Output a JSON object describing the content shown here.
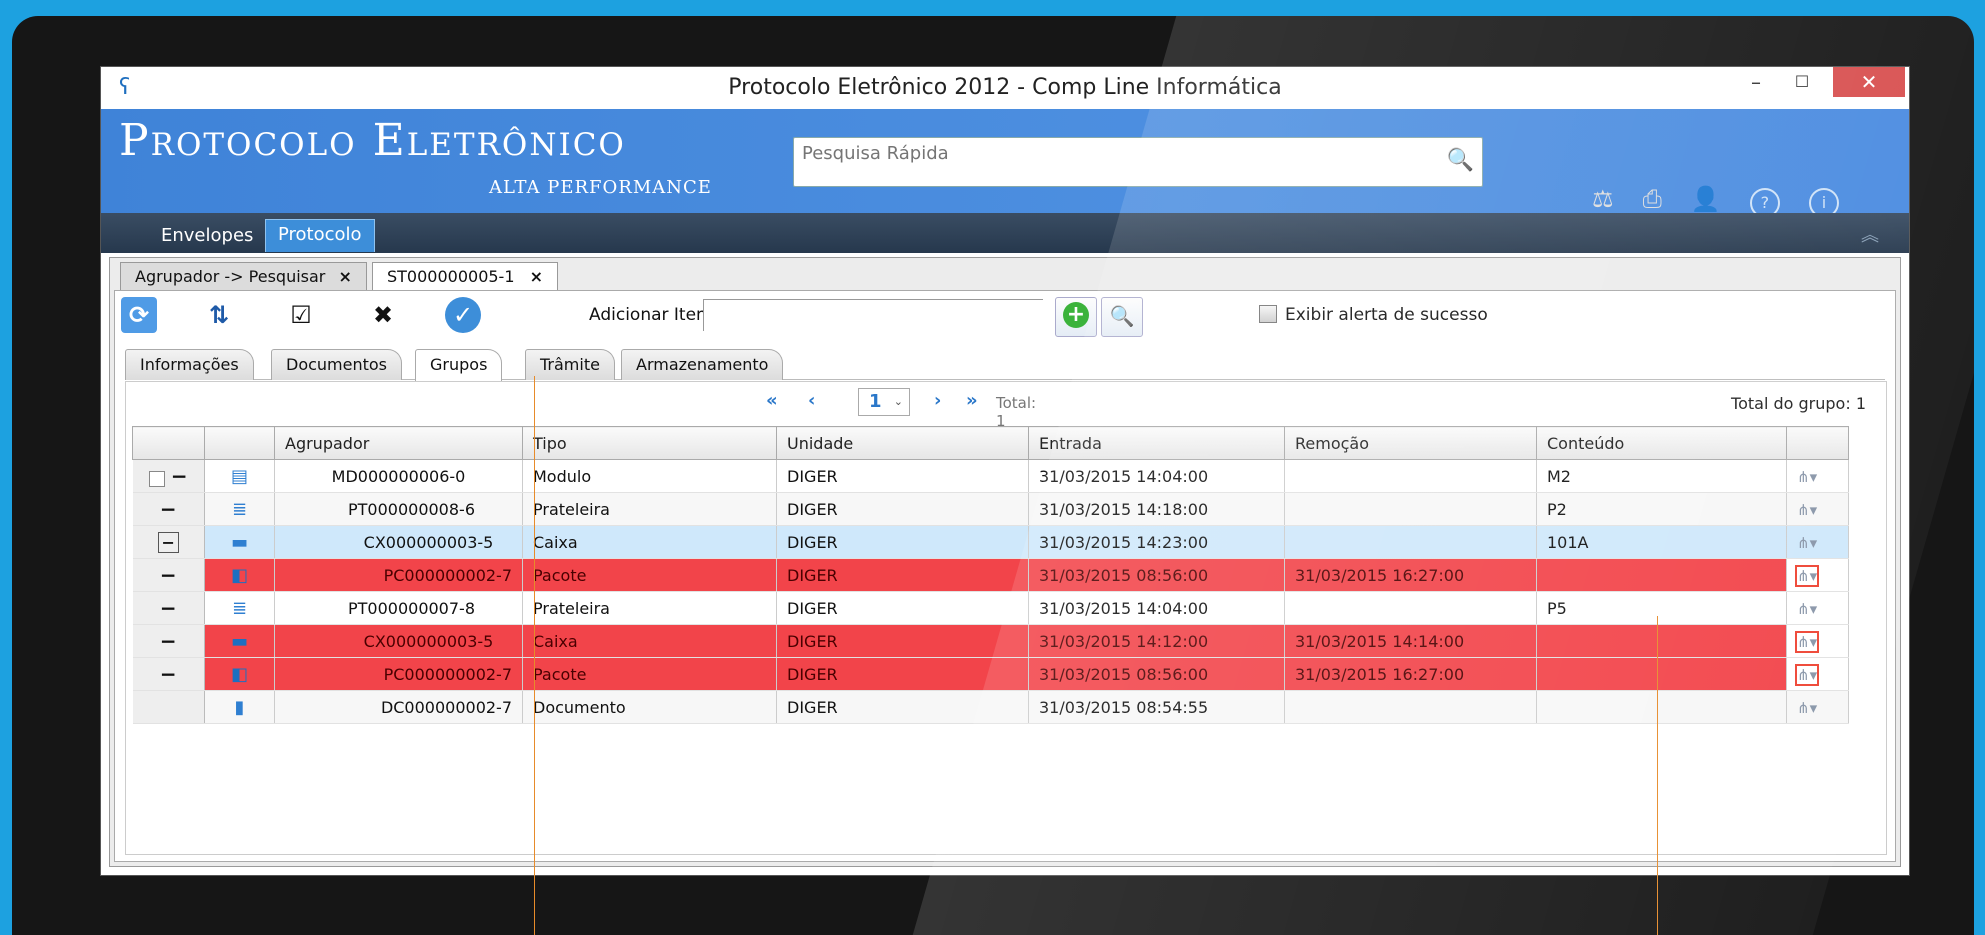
{
  "window": {
    "title": "Protocolo Eletrônico 2012 - Comp Line Informática",
    "minimize": "–",
    "maximize": "☐",
    "close": "✕"
  },
  "banner": {
    "brand": "Protocolo Eletrônico",
    "subtitle": "ALTA PERFORMANCE",
    "search_placeholder": "Pesquisa Rápida"
  },
  "menu": {
    "items": [
      "Envelopes",
      "Protocolo"
    ],
    "active": "Protocolo"
  },
  "doc_tabs": [
    {
      "label": "Agrupador -> Pesquisar",
      "close": "×"
    },
    {
      "label": "ST000000005-1",
      "close": "×"
    }
  ],
  "toolbar": {
    "add_item_label": "Adicionar Item:",
    "add_item_value": "",
    "success_alert_label": "Exibir alerta de sucesso"
  },
  "sub_tabs": [
    "Informações",
    "Documentos",
    "Grupos",
    "Trâmite",
    "Armazenamento"
  ],
  "pager": {
    "first": "«",
    "prev": "‹",
    "page": "1",
    "next": "›",
    "last": "»",
    "total": "Total: 1",
    "group_total": "Total do grupo: 1"
  },
  "grid": {
    "columns": [
      "Agrupador",
      "Tipo",
      "Unidade",
      "Entrada",
      "Remoção",
      "Conteúdo"
    ],
    "rows": [
      {
        "agrupador": "MD000000006-0",
        "tipo": "Modulo",
        "unidade": "DIGER",
        "entrada": "31/03/2015 14:04:00",
        "remocao": "",
        "conteudo": "M2"
      },
      {
        "agrupador": "PT000000008-6",
        "tipo": "Prateleira",
        "unidade": "DIGER",
        "entrada": "31/03/2015 14:18:00",
        "remocao": "",
        "conteudo": "P2"
      },
      {
        "agrupador": "CX000000003-5",
        "tipo": "Caixa",
        "unidade": "DIGER",
        "entrada": "31/03/2015 14:23:00",
        "remocao": "",
        "conteudo": "101A"
      },
      {
        "agrupador": "PC000000002-7",
        "tipo": "Pacote",
        "unidade": "DIGER",
        "entrada": "31/03/2015 08:56:00",
        "remocao": "31/03/2015 16:27:00",
        "conteudo": ""
      },
      {
        "agrupador": "PT000000007-8",
        "tipo": "Prateleira",
        "unidade": "DIGER",
        "entrada": "31/03/2015 14:04:00",
        "remocao": "",
        "conteudo": "P5"
      },
      {
        "agrupador": "CX000000003-5",
        "tipo": "Caixa",
        "unidade": "DIGER",
        "entrada": "31/03/2015 14:12:00",
        "remocao": "31/03/2015 14:14:00",
        "conteudo": ""
      },
      {
        "agrupador": "PC000000002-7",
        "tipo": "Pacote",
        "unidade": "DIGER",
        "entrada": "31/03/2015 08:56:00",
        "remocao": "31/03/2015 16:27:00",
        "conteudo": ""
      },
      {
        "agrupador": "DC000000002-7",
        "tipo": "Documento",
        "unidade": "DIGER",
        "entrada": "31/03/2015 08:54:55",
        "remocao": "",
        "conteudo": ""
      }
    ]
  },
  "colors": {
    "banner": "#4a8be0",
    "removed_row": "#f2444a",
    "selected_row": "#cfe8fb",
    "callout": "#e78b2a"
  }
}
